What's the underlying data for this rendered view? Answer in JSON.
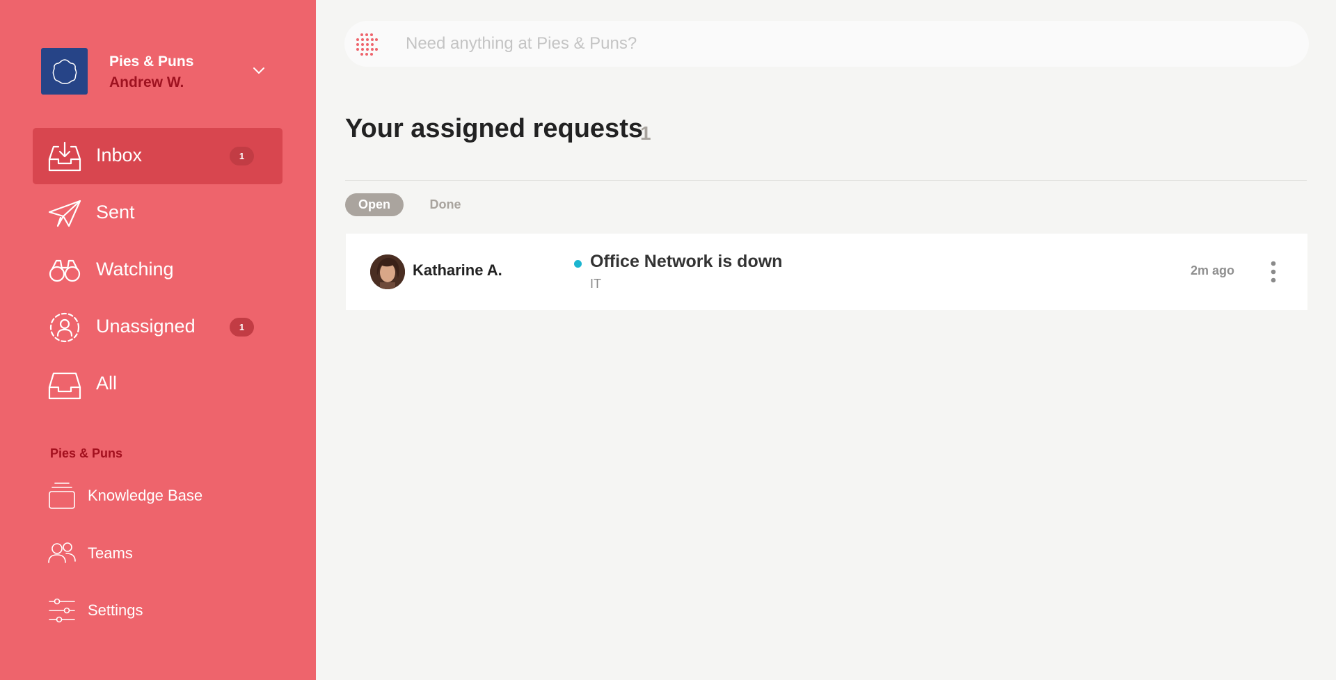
{
  "workspace": {
    "name": "Pies & Puns",
    "user": "Andrew W.",
    "logo_icon": "flower-outline-icon",
    "chevron_icon": "chevron-down-icon"
  },
  "nav": [
    {
      "label": "Inbox",
      "badge": "1",
      "icon": "inbox-download-icon",
      "active": true
    },
    {
      "label": "Sent",
      "icon": "paper-plane-icon"
    },
    {
      "label": "Watching",
      "icon": "binoculars-icon"
    },
    {
      "label": "Unassigned",
      "badge": "1",
      "icon": "unassigned-user-icon"
    },
    {
      "label": "All",
      "icon": "tray-icon"
    }
  ],
  "section": {
    "label": "Pies & Puns",
    "items": [
      {
        "label": "Knowledge Base",
        "icon": "stacked-cards-icon"
      },
      {
        "label": "Teams",
        "icon": "people-icon"
      },
      {
        "label": "Settings",
        "icon": "sliders-icon"
      }
    ]
  },
  "search": {
    "placeholder": "Need anything at Pies & Puns?",
    "value": ""
  },
  "main": {
    "title": "Your assigned requests",
    "count": "1",
    "tabs": [
      {
        "label": "Open",
        "selected": true
      },
      {
        "label": "Done",
        "selected": false
      }
    ],
    "requests": [
      {
        "requester": "Katharine A.",
        "title": "Office Network is down",
        "category": "IT",
        "time": "2m ago",
        "status_color": "#1bb5d0"
      }
    ]
  },
  "colors": {
    "sidebar": "#ee646c",
    "active_nav": "#d8464f",
    "accent_dark": "#a3101e",
    "workspace_logo": "#264487"
  }
}
